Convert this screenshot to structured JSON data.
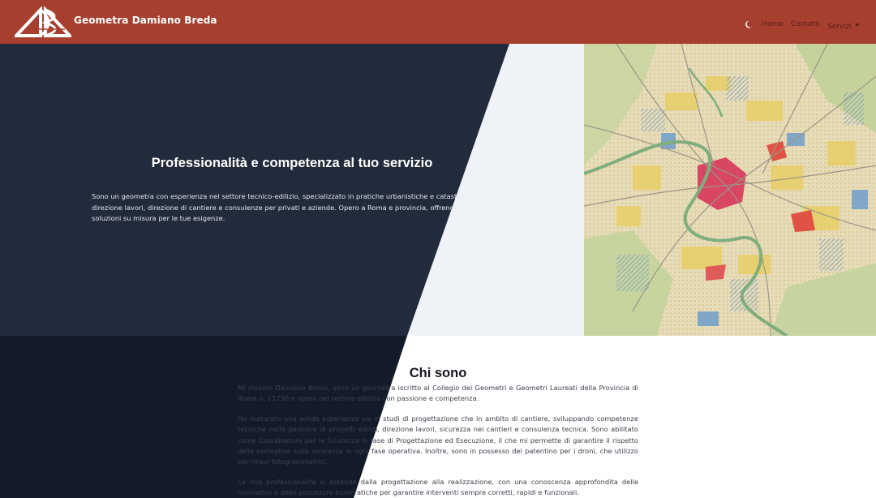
{
  "navbar": {
    "brand": "Geometra Damiano Breda",
    "links": [
      {
        "label": "Home"
      },
      {
        "label": "Contatti"
      },
      {
        "label": "Servizi"
      }
    ],
    "icons": {
      "logo": "db-triangle-logo",
      "theme_toggle": "moon-icon",
      "dropdown": "chevron-down-icon"
    },
    "colors": {
      "bar": "#a63f2e",
      "link": "#5a2118",
      "brand_text": "#ffffff"
    }
  },
  "hero": {
    "title": "Professionalità e competenza al tuo servizio",
    "text": "Sono un geometra con esperienza nel settore tecnico-edilizio, specializzato in pratiche urbanistiche e catastali, direzione lavori, direzione di cantiere e consulenze per privati e aziende. Opero a Roma e provincia, offrendo soluzioni su misura per le tue esigenze.",
    "image": "urban-planning-map-of-rome",
    "colors": {
      "dark": "#222b3b",
      "light": "#eff2f7"
    }
  },
  "about": {
    "title": "Chi sono",
    "paragraphs": [
      "Mi chiamo Damiano Breda, sono un geometra iscritto al Collegio dei Geometri e Geometri Laureati della Provincia di Roma n. 11750 e opero nel settore edilizio con passione e competenza.",
      "Ho maturato una solida esperienza sia in studi di progettazione che in ambito di cantiere, sviluppando competenze tecniche nella gestione di progetti edilizi, direzione lavori, sicurezza nei cantieri e consulenza tecnica. Sono abilitato come Coordinatore per la Sicurezza in fase di Progettazione ed Esecuzione, il che mi permette di garantire il rispetto delle normative sulla sicurezza in ogni fase operativa. Inoltre, sono in possesso del patentino per i droni, che utilizzo per rilievi fotogrammetrici.",
      "La mia professionalità si estende dalla progettazione alla realizzazione, con una conoscenza approfondita delle normative e delle procedure burocratiche per garantire interventi sempre corretti, rapidi e funzionali."
    ],
    "colors": {
      "dark": "#131a2a"
    }
  }
}
